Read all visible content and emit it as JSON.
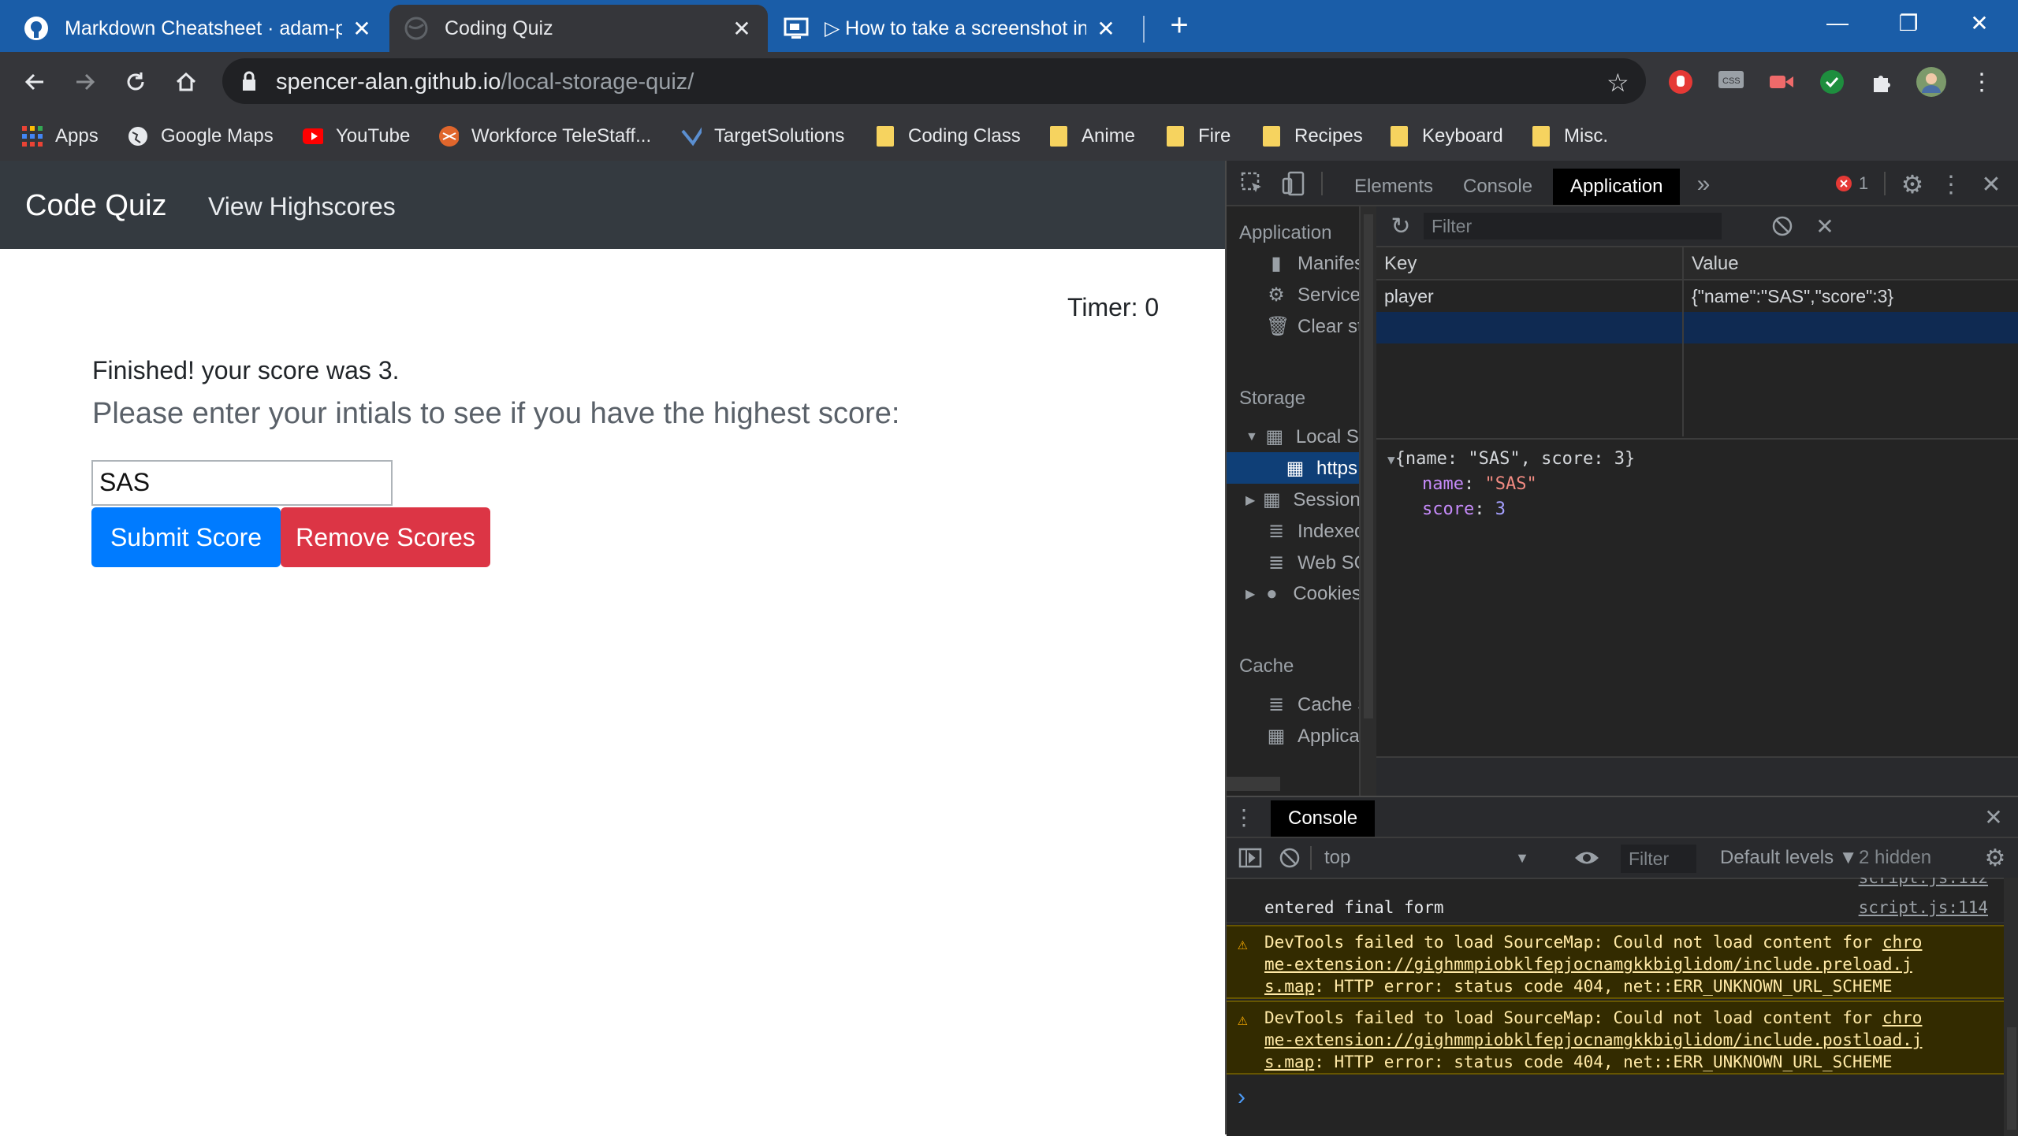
{
  "browser": {
    "tabs": [
      {
        "title": "Markdown Cheatsheet · adam-p/",
        "close": "✕"
      },
      {
        "title": "Coding Quiz",
        "close": "✕"
      },
      {
        "title": "▷ How to take a screenshot in W",
        "close": "✕"
      }
    ],
    "new_tab": "+",
    "window": {
      "minimize": "—",
      "restore": "❐",
      "close": "✕"
    },
    "url_host": "spencer-alan.github.io",
    "url_path": "/local-storage-quiz/",
    "bookmarks": [
      "Apps",
      "Google Maps",
      "YouTube",
      "Workforce TeleStaff...",
      "TargetSolutions",
      "Coding Class",
      "Anime",
      "Fire",
      "Recipes",
      "Keyboard",
      "Misc."
    ]
  },
  "page": {
    "brand": "Code Quiz",
    "nav_link": "View Highscores",
    "timer": "Timer: 0",
    "finished": "Finished! your score was 3.",
    "prompt": "Please enter your intials to see if you have the highest score:",
    "initials_value": "SAS",
    "submit_label": "Submit Score",
    "remove_label": "Remove Scores"
  },
  "devtools": {
    "tabs": [
      "Elements",
      "Console",
      "Application"
    ],
    "more": "»",
    "error_count": "1",
    "sidebar": {
      "app_head": "Application",
      "app_items": [
        "Manifest",
        "Service Workers",
        "Clear storage"
      ],
      "storage_head": "Storage",
      "storage_items": [
        "Local Storage",
        "https://spencer-alan.github.io",
        "Session Storage",
        "IndexedDB",
        "Web SQL",
        "Cookies"
      ],
      "cache_head": "Cache",
      "cache_items": [
        "Cache Storage",
        "Application Cache"
      ]
    },
    "storage_filter_placeholder": "Filter",
    "kv": {
      "key_header": "Key",
      "value_header": "Value",
      "rows": [
        {
          "key": "player",
          "value": "{\"name\":\"SAS\",\"score\":3}"
        }
      ]
    },
    "preview": {
      "summary": "{name: \"SAS\", score: 3}",
      "name_key": "name",
      "name_val": "\"SAS\"",
      "score_key": "score",
      "score_val": "3"
    },
    "drawer_tab": "Console",
    "console": {
      "context": "top",
      "filter_placeholder": "Filter",
      "levels": "Default levels ▼",
      "hidden": "2 hidden",
      "truncated_src": "script.js:112",
      "messages": [
        {
          "text": "entered final form",
          "src": "script.js:114"
        }
      ],
      "warnings": [
        {
          "prefix": "DevTools failed to load SourceMap: Could not load content for ",
          "link1": "chro",
          "link2": "me-extension://gighmmpiobklfepjocnamgkkbiglidom/include.preload.j",
          "link3": "s.map",
          "suffix": ": HTTP error: status code 404, net::ERR_UNKNOWN_URL_SCHEME"
        },
        {
          "prefix": "DevTools failed to load SourceMap: Could not load content for ",
          "link1": "chro",
          "link2": "me-extension://gighmmpiobklfepjocnamgkkbiglidom/include.postload.j",
          "link3": "s.map",
          "suffix": ": HTTP error: status code 404, net::ERR_UNKNOWN_URL_SCHEME"
        }
      ],
      "prompt": "›"
    }
  },
  "colors": {
    "titlebar": "#1a5da8",
    "chrome_dark": "#35363a",
    "navbar": "#343a40",
    "primary": "#007bff",
    "danger": "#dc3545",
    "devtools_bg": "#242424",
    "selection": "#0f3f77"
  }
}
